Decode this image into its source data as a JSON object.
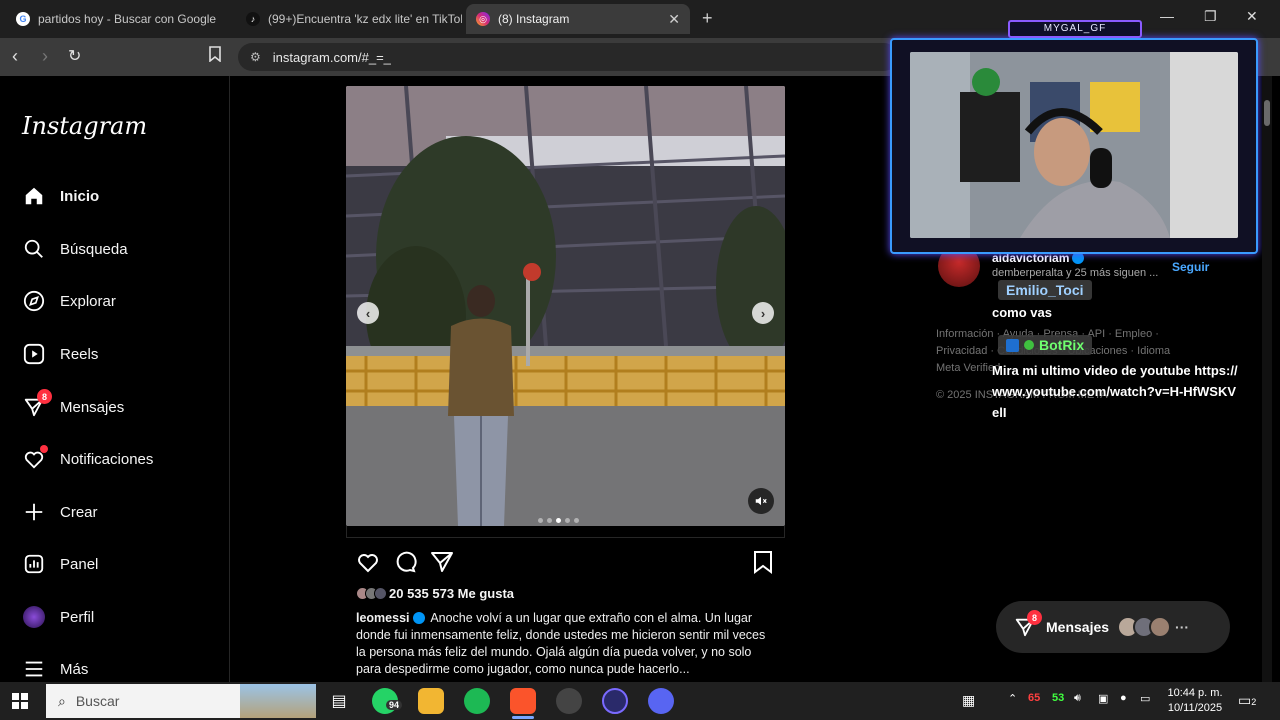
{
  "browser": {
    "tabs": [
      {
        "title": "partidos hoy - Buscar con Google",
        "favicon": "G",
        "active": false
      },
      {
        "title": "(99+)Encuentra 'kz edx lite' en TikTok",
        "favicon": "♪",
        "active": false
      },
      {
        "title": "(8) Instagram",
        "favicon": "◎",
        "active": true
      }
    ],
    "close_glyph": "✕",
    "new_tab_glyph": "+",
    "url": "instagram.com/#_=_"
  },
  "sidebar": {
    "logo": "Instagram",
    "items": [
      {
        "label": "Inicio",
        "icon": "home-icon",
        "bold": true
      },
      {
        "label": "Búsqueda",
        "icon": "search-icon"
      },
      {
        "label": "Explorar",
        "icon": "compass-icon"
      },
      {
        "label": "Reels",
        "icon": "reels-icon"
      },
      {
        "label": "Mensajes",
        "icon": "messenger-icon",
        "badge": "8"
      },
      {
        "label": "Notificaciones",
        "icon": "heart-icon",
        "dot": true
      },
      {
        "label": "Crear",
        "icon": "plus-icon"
      },
      {
        "label": "Panel",
        "icon": "chart-icon"
      },
      {
        "label": "Perfil",
        "icon": "profile-avatar-icon"
      },
      {
        "label": "Más",
        "icon": "hamburger-icon"
      }
    ]
  },
  "post": {
    "likes": "20 535 573 Me gusta",
    "caption_user": "leomessi",
    "caption_text": "Anoche volví a un lugar que extraño con el alma. Un lugar donde fui inmensamente feliz, donde ustedes me hicieron sentir mil veces la persona más feliz del mundo. Ojalá algún día pueda volver, y no solo para despedirme como jugador, como nunca pude hacerlo...",
    "carousel_dots": 5,
    "carousel_active": 3
  },
  "suggestion": {
    "name": "aidavictoriam",
    "subtitle": "demberperalta y 25 más siguen ...",
    "follow": "Seguir"
  },
  "footer": {
    "line1": "Información · Ayuda · Prensa · API · Empleo ·",
    "line2": "Privacidad · Condiciones · Ubicaciones · Idioma",
    "line3": "Meta Verified",
    "copyright": "© 2025 INSTAGRAM FROM META"
  },
  "stream": {
    "cam_label": "MYGAL_GF",
    "chat": [
      {
        "user": "Emilio_Toci",
        "message": "como vas"
      },
      {
        "user": "BotRix",
        "message": "Mira mi ultimo video de youtube https://www.youtube.com/watch?v=H-HfWSKVelI"
      }
    ]
  },
  "messages_pill": {
    "label": "Mensajes",
    "badge": "8",
    "more": "···"
  },
  "taskbar": {
    "search_placeholder": "Buscar",
    "whatsapp_badge": "94",
    "tray_a": "65",
    "tray_b": "53",
    "time": "10:44 p. m.",
    "date": "10/11/2025",
    "notif_count": "2"
  },
  "colors": {
    "accent_blue": "#0095f6",
    "badge_red": "#ff3040"
  }
}
